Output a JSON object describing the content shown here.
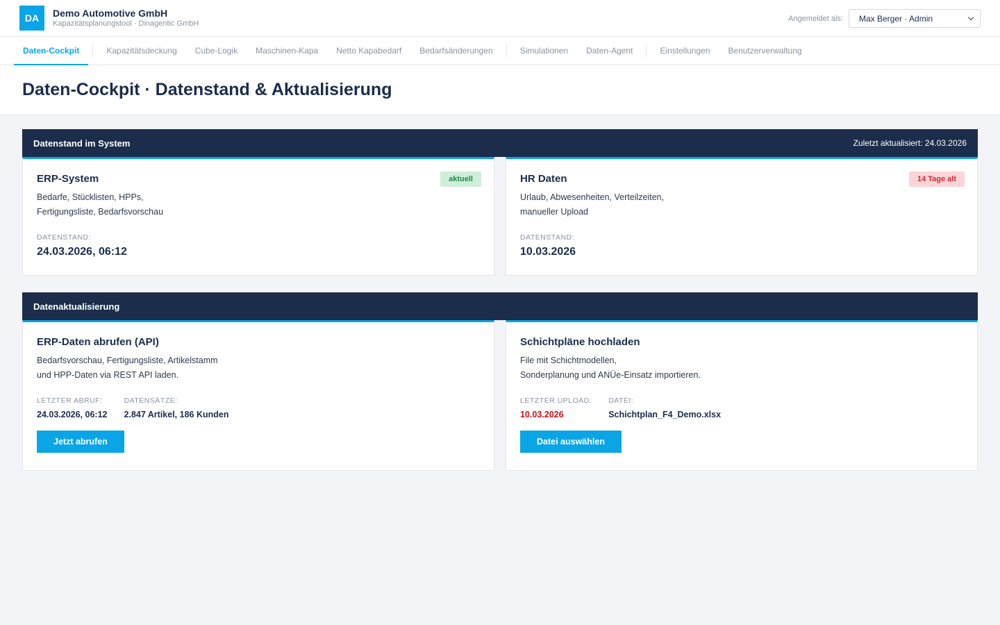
{
  "header": {
    "logo_text": "DA",
    "company": "Demo Automotive GmbH",
    "subtitle": "Kapazitätsplanungstool · Dinagentic GmbH",
    "user_label": "Angemeldet als:",
    "user_value": "Max Berger · Admin"
  },
  "nav": {
    "items": [
      "Daten-Cockpit",
      "Kapazitätsdeckung",
      "Cube-Logik",
      "Maschinen-Kapa",
      "Netto Kapabedarf",
      "Bedarfsänderungen",
      "Simulationen",
      "Daten-Agent",
      "Einstellungen",
      "Benutzerverwaltung"
    ]
  },
  "page": {
    "title": "Daten-Cockpit · Datenstand & Aktualisierung"
  },
  "datenstand": {
    "title": "Datenstand im System",
    "updated": "Zuletzt aktualisiert: 24.03.2026",
    "erp": {
      "title": "ERP-System",
      "badge": "aktuell",
      "desc1": "Bedarfe, Stücklisten, HPPs,",
      "desc2": "Fertigungsliste, Bedarfsvorschau",
      "label": "DATENSTAND:",
      "value": "24.03.2026, 06:12"
    },
    "hr": {
      "title": "HR Daten",
      "badge": "14 Tage alt",
      "desc1": "Urlaub, Abwesenheiten, Verteilzeiten,",
      "desc2": "manueller Upload",
      "label": "DATENSTAND:",
      "value": "10.03.2026"
    }
  },
  "aktualisierung": {
    "title": "Datenaktualisierung",
    "erp": {
      "title": "ERP-Daten abrufen (API)",
      "desc1": "Bedarfsvorschau, Fertigungsliste, Artikelstamm",
      "desc2": "und HPP-Daten via REST API laden.",
      "label1": "LETZTER ABRUF:",
      "value1": "24.03.2026, 06:12",
      "label2": "DATENSÄTZE:",
      "value2": "2.847 Artikel, 186 Kunden",
      "button": "Jetzt abrufen"
    },
    "schicht": {
      "title": "Schichtpläne hochladen",
      "desc1": "File mit Schichtmodellen,",
      "desc2": "Sonderplanung und ANÜe-Einsatz importieren.",
      "label1": "LETZTER UPLOAD:",
      "value1": "10.03.2026",
      "label2": "DATEI:",
      "value2": "Schichtplan_F4_Demo.xlsx",
      "button": "Datei auswählen"
    }
  },
  "colors": {
    "accent": "#0aa5e6",
    "navy": "#1b2d4a",
    "ok": "#1e8a43",
    "warn": "#d12a35"
  }
}
